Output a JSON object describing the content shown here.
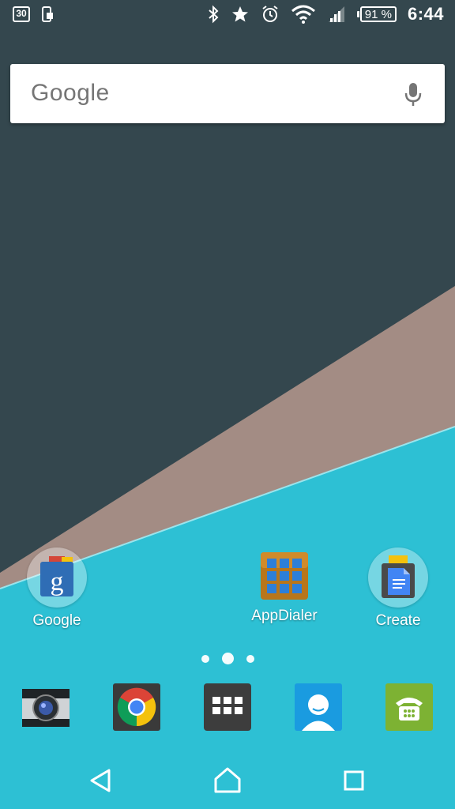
{
  "status_bar": {
    "calendar_day": "30",
    "battery_percent": "91 %",
    "time": "6:44",
    "icons": [
      "calendar-icon",
      "phone-icon",
      "bluetooth-icon",
      "star-icon",
      "alarm-icon",
      "wifi-icon",
      "signal-icon",
      "battery-icon"
    ]
  },
  "search": {
    "logo_text": "Google",
    "icon": "mic-icon"
  },
  "apps": [
    {
      "label": "Google",
      "icon": "google-folder-icon"
    },
    {
      "label": "AppDialer",
      "icon": "appdialer-icon"
    },
    {
      "label": "Create",
      "icon": "create-folder-icon"
    }
  ],
  "page_indicator": {
    "pages": 3,
    "current": 2
  },
  "dock": [
    {
      "name": "camera-icon"
    },
    {
      "name": "chrome-icon"
    },
    {
      "name": "app-drawer-icon"
    },
    {
      "name": "contacts-icon"
    },
    {
      "name": "phone-dialer-icon"
    }
  ],
  "nav_bar": [
    "back-icon",
    "home-icon",
    "recents-icon"
  ],
  "colors": {
    "wallpaper_top": "#34474e",
    "wallpaper_band": "#a38c84",
    "wallpaper_bottom": "#2dc0d4"
  }
}
